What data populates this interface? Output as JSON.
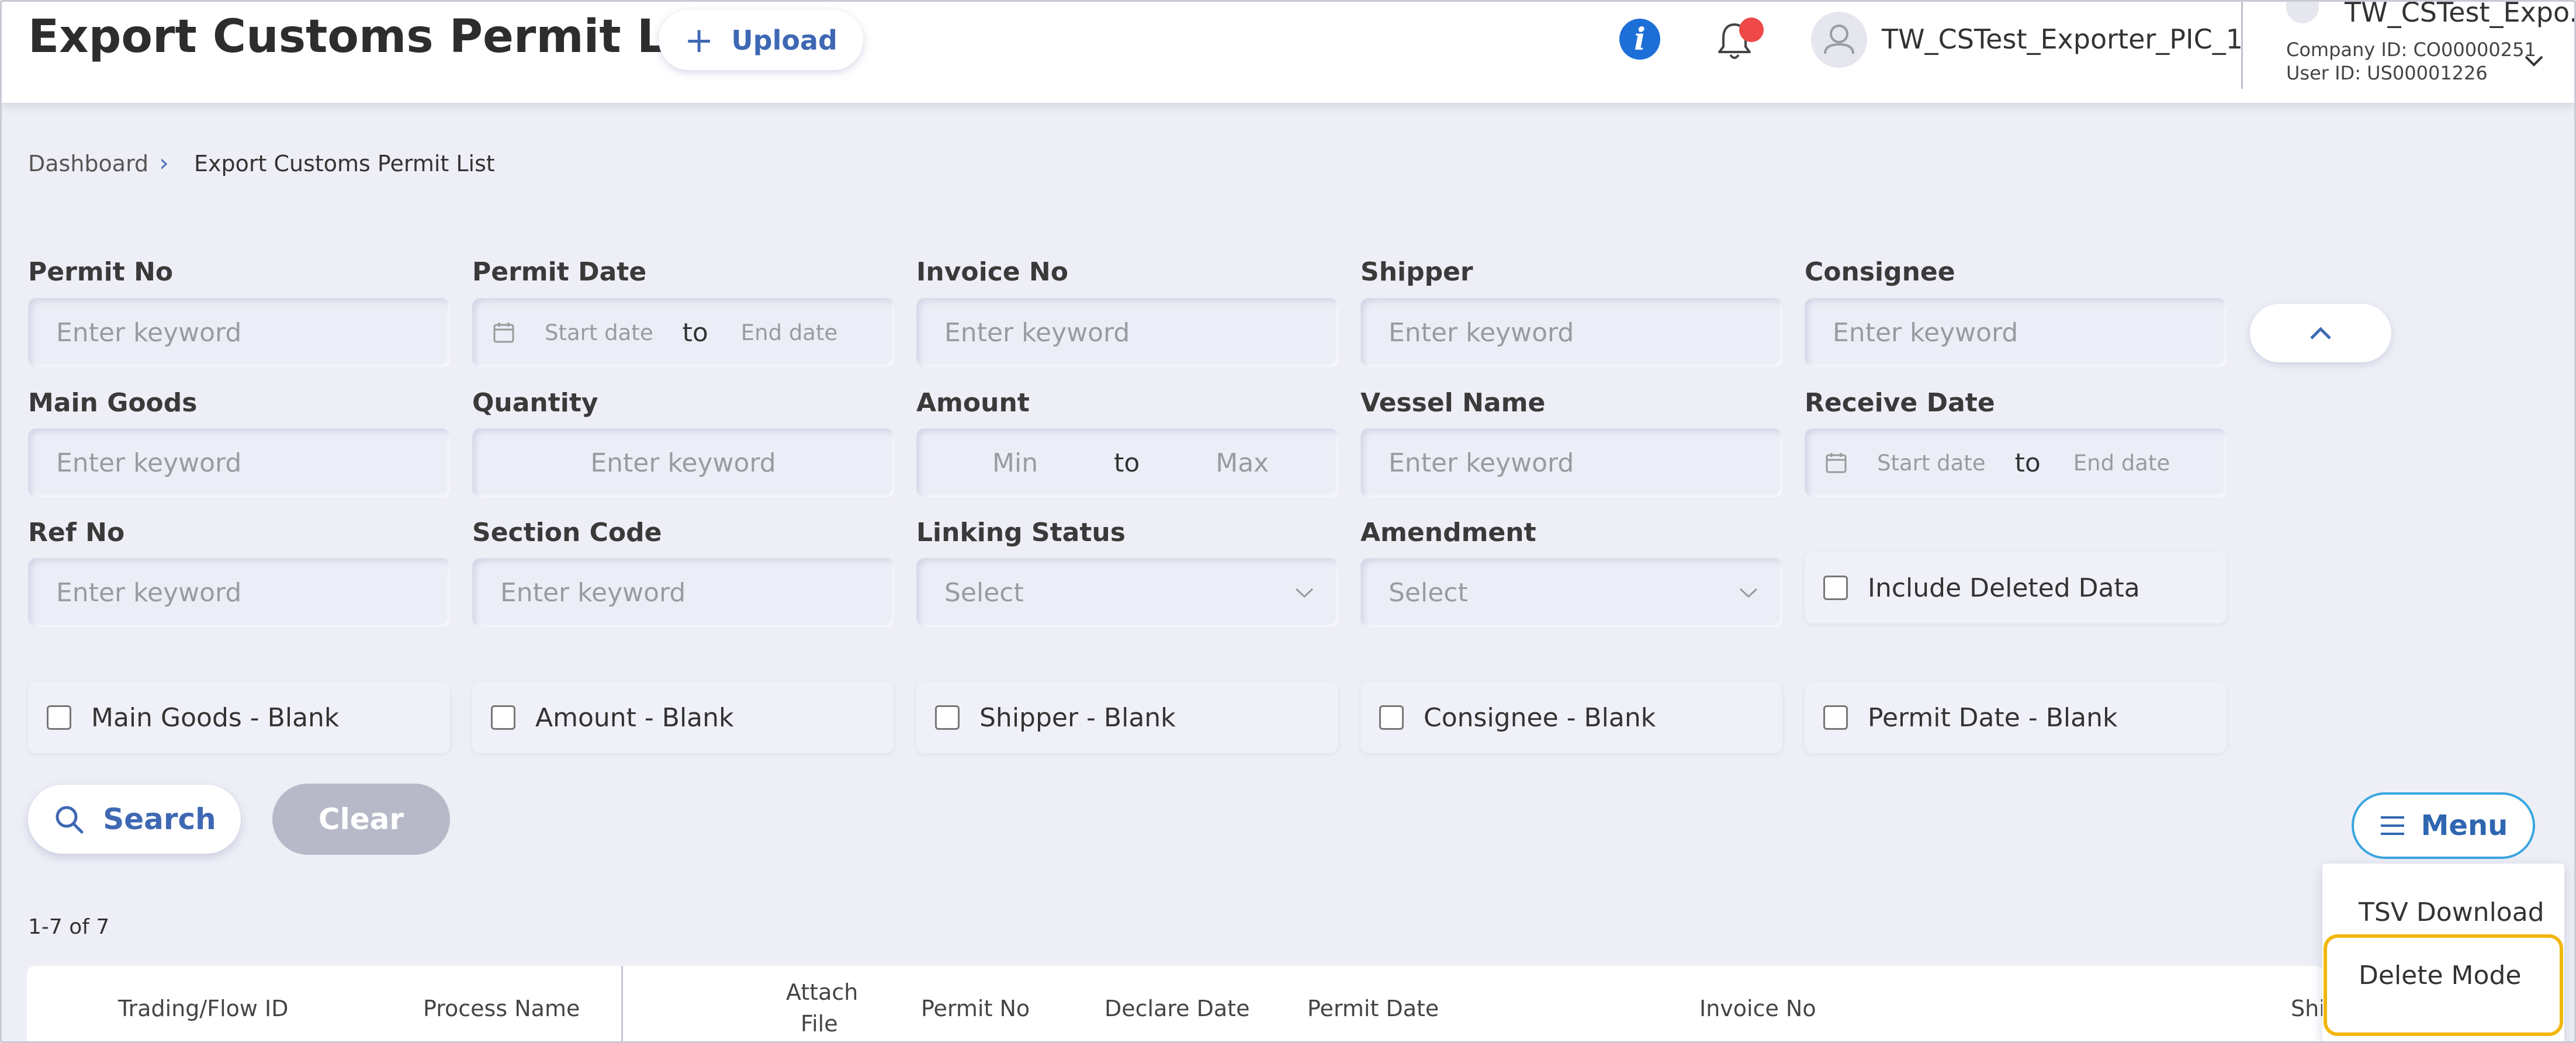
{
  "header": {
    "title": "Export Customs Permit List",
    "upload_label": "Upload",
    "user_name": "TW_CSTest_Exporter_PIC_1",
    "company_name": "TW_CSTest_Expo...",
    "company_id": "Company ID: CO00000251",
    "user_id": "User ID: US00001226",
    "icons": [
      "info-icon",
      "bell-icon",
      "user-avatar-icon",
      "building-icon",
      "chevron-down-icon"
    ],
    "accent_color": "#3f68b4",
    "notification_dot_color": "#ee4848"
  },
  "breadcrumb": {
    "home": "Dashboard",
    "separator": "›",
    "current": "Export Customs Permit List"
  },
  "filters": {
    "permit_no": {
      "label": "Permit No",
      "placeholder": "Enter keyword"
    },
    "permit_date": {
      "label": "Permit Date",
      "start": "Start date",
      "to": "to",
      "end": "End date"
    },
    "invoice_no": {
      "label": "Invoice No",
      "placeholder": "Enter keyword"
    },
    "shipper": {
      "label": "Shipper",
      "placeholder": "Enter keyword"
    },
    "consignee": {
      "label": "Consignee",
      "placeholder": "Enter keyword"
    },
    "main_goods": {
      "label": "Main Goods",
      "placeholder": "Enter keyword"
    },
    "quantity": {
      "label": "Quantity",
      "placeholder": "Enter keyword"
    },
    "amount": {
      "label": "Amount",
      "min": "Min",
      "to": "to",
      "max": "Max"
    },
    "vessel_name": {
      "label": "Vessel Name",
      "placeholder": "Enter keyword"
    },
    "receive_date": {
      "label": "Receive Date",
      "start": "Start date",
      "to": "to",
      "end": "End date"
    },
    "ref_no": {
      "label": "Ref No",
      "placeholder": "Enter keyword"
    },
    "section_code": {
      "label": "Section Code",
      "placeholder": "Enter keyword"
    },
    "linking_status": {
      "label": "Linking Status",
      "value": "Select"
    },
    "amendment": {
      "label": "Amendment",
      "value": "Select"
    },
    "include_deleted": "Include Deleted Data",
    "blank_checks": {
      "main_goods": "Main Goods - Blank",
      "amount": "Amount - Blank",
      "shipper": "Shipper - Blank",
      "consignee": "Consignee - Blank",
      "permit_date": "Permit Date - Blank"
    }
  },
  "actions": {
    "search_label": "Search",
    "clear_label": "Clear",
    "menu_label": "Menu",
    "menu_items": [
      "TSV Download",
      "Delete Mode"
    ],
    "highlight_color": "#f2b70d"
  },
  "results": {
    "count": "1-7 of 7",
    "columns": {
      "trading_flow_id": "Trading/Flow ID",
      "process_name": "Process Name",
      "attach_file_1": "Attach",
      "attach_file_2": "File",
      "permit_no": "Permit No",
      "declare_date": "Declare Date",
      "permit_date": "Permit Date",
      "invoice_no": "Invoice No",
      "shipper": "Shi"
    }
  }
}
